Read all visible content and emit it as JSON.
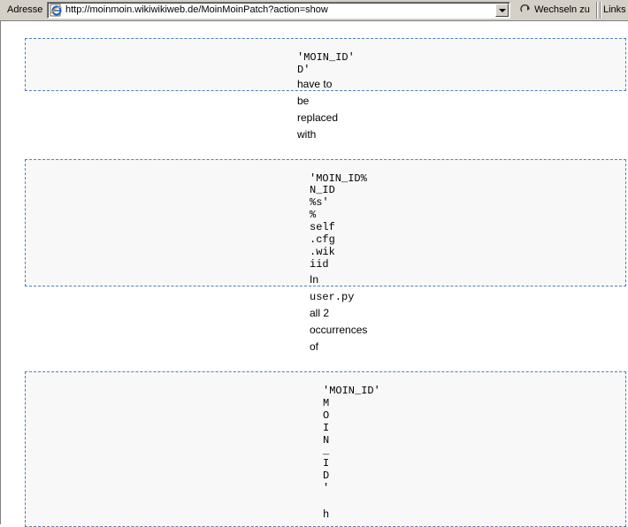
{
  "address_bar": {
    "label": "Adresse",
    "url": "http://moinmoin.wikiwikiweb.de/MoinMoinPatch?action=show",
    "go_label": "Wechseln zu",
    "links_label": "Links"
  },
  "content": {
    "block1": {
      "code_lines": [
        "'MOIN_ID'",
        "D'"
      ],
      "text_lines": [
        "have to",
        "be",
        "replaced",
        "with"
      ]
    },
    "block2": {
      "code_lines": [
        "'MOIN_ID%",
        "N_ID",
        "%s'",
        "%",
        "self",
        ".cfg",
        ".wik",
        "iid"
      ],
      "text_lines": [
        "In"
      ],
      "code_after": [
        "user.py"
      ],
      "text_after": [
        "all 2",
        "occurrences",
        "of"
      ]
    },
    "block3": {
      "code_lines": [
        "'MOIN_ID'",
        "M",
        "O",
        "I",
        "N",
        "_",
        "I",
        "D",
        "'",
        "",
        "h"
      ]
    }
  }
}
